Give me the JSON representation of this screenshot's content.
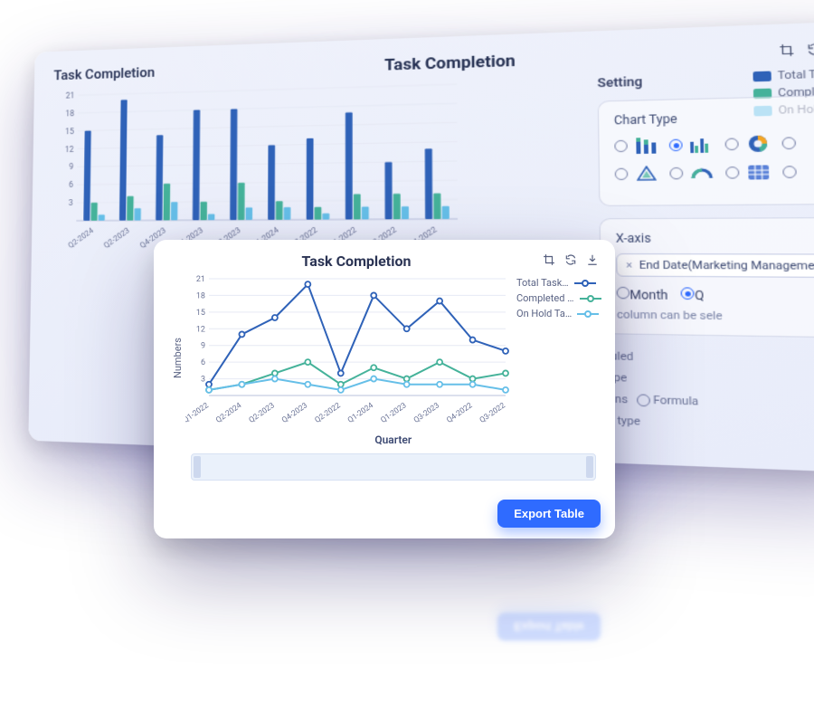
{
  "back": {
    "panel_title": "Task Completion",
    "chart_title": "Task Completion",
    "legend": {
      "total": "Total Task…",
      "completed": "Completed …",
      "onhold": "On Hold Ta…"
    }
  },
  "front": {
    "chart_title": "Task Completion",
    "ylabel": "Numbers",
    "xlabel": "Quarter",
    "legend": {
      "total": "Total Task…",
      "completed": "Completed …",
      "onhold": "On Hold Ta…"
    },
    "export_label": "Export Table"
  },
  "settings": {
    "title": "Setting",
    "chart_type_label": "Chart Type",
    "xaxis_label": "X-axis",
    "xaxis_chip": "End Date(Marketing Management)",
    "period_month": "Month",
    "period_quarter": "Q",
    "column_hint": "column can be sele",
    "formula_option": "Formula",
    "extra1": "luled",
    "extra2": "ype",
    "extra3": "nns",
    "extra4": "y type"
  },
  "colors": {
    "total": "#2f62b8",
    "completed": "#45b29a",
    "onhold": "#66bfe8",
    "grid": "#e6e9f4",
    "axis": "#6a7396",
    "accent": "#2f6bff"
  },
  "chart_data": [
    {
      "id": "back_bar",
      "type": "bar",
      "title": "Task Completion",
      "xlabel": "Quarter",
      "ylabel": "",
      "ylim": [
        0,
        21
      ],
      "yticks": [
        3,
        6,
        9,
        12,
        15,
        18,
        21
      ],
      "categories": [
        "Q2-2024",
        "Q2-2023",
        "Q4-2023",
        "Q1-2023",
        "Q3-2023",
        "Q1-2024",
        "Q2-2022",
        "Q1-2022",
        "Q3-2022",
        "Q4-2022"
      ],
      "series": [
        {
          "name": "Total Task…",
          "color": "#2f62b8",
          "values": [
            15,
            20,
            14,
            18,
            18,
            12,
            13,
            17,
            9,
            11
          ]
        },
        {
          "name": "Completed …",
          "color": "#45b29a",
          "values": [
            3,
            4,
            6,
            3,
            6,
            3,
            2,
            4,
            4,
            4
          ]
        },
        {
          "name": "On Hold Ta…",
          "color": "#66bfe8",
          "values": [
            1,
            2,
            3,
            1,
            2,
            2,
            1,
            2,
            2,
            2
          ]
        }
      ]
    },
    {
      "id": "front_line",
      "type": "line",
      "title": "Task Completion",
      "xlabel": "Quarter",
      "ylabel": "Numbers",
      "ylim": [
        0,
        21
      ],
      "yticks": [
        3,
        6,
        9,
        12,
        15,
        18,
        21
      ],
      "categories": [
        "Q1-2022",
        "Q2-2024",
        "Q2-2023",
        "Q4-2023",
        "Q2-2022",
        "Q1-2024",
        "Q1-2023",
        "Q3-2023",
        "Q4-2022",
        "Q3-2022"
      ],
      "series": [
        {
          "name": "Total Task…",
          "color": "#2f62b8",
          "values": [
            2,
            11,
            14,
            20,
            4,
            18,
            12,
            17,
            10,
            8
          ]
        },
        {
          "name": "Completed …",
          "color": "#45b29a",
          "values": [
            1,
            2,
            4,
            6,
            2,
            5,
            3,
            6,
            3,
            4
          ]
        },
        {
          "name": "On Hold Ta…",
          "color": "#66bfe8",
          "values": [
            1,
            2,
            3,
            2,
            1,
            3,
            2,
            2,
            2,
            1
          ]
        }
      ]
    }
  ]
}
